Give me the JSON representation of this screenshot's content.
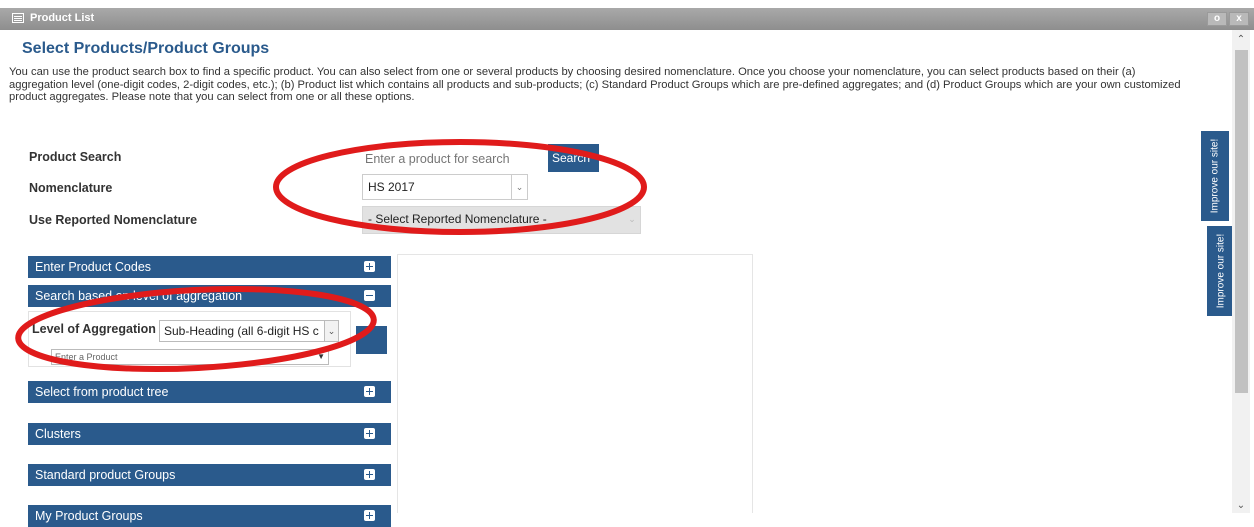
{
  "window": {
    "title": "Product List",
    "buttons": {
      "help": "o",
      "close": "x"
    }
  },
  "page": {
    "heading": "Select Products/Product Groups",
    "intro": "You can use the product search box to find a specific product. You can also select from one or several products by choosing desired nomenclature. Once you choose your nomenclature, you can select products based on their (a) aggregation level (one-digit codes, 2-digit codes, etc.); (b) Product list which contains all products and sub-products; (c) Standard Product Groups which are pre-defined aggregates; and (d) Product Groups which are your own customized product aggregates. Please note that you can select from one or all these options."
  },
  "form": {
    "product_search_label": "Product Search",
    "product_search_placeholder": "Enter a product for search",
    "search_button": "Search",
    "nomenclature_label": "Nomenclature",
    "nomenclature_value": "HS 2017",
    "reported_label": "Use Reported Nomenclature",
    "reported_value": "- Select Reported Nomenclature -"
  },
  "accordion": {
    "enter_codes": "Enter Product Codes",
    "search_level": "Search based on level of aggregation",
    "level_label": "Level of Aggregation",
    "level_value": "Sub-Heading (all 6-digit HS c",
    "product_placeholder": "Enter a Product",
    "product_tree": "Select from product tree",
    "clusters": "Clusters",
    "standard_groups": "Standard product Groups",
    "my_groups": "My Product Groups"
  },
  "side_tabs": {
    "improve_1": "Improve our site!",
    "improve_2": "Improve our site!"
  },
  "colors": {
    "brand_blue": "#2a5a8c",
    "annotation_red": "#e01b1b"
  },
  "icons": {
    "window": "window-icon",
    "expand": "plus-square-icon",
    "collapse": "minus-square-icon",
    "dropdown": "chevron-down-icon"
  }
}
